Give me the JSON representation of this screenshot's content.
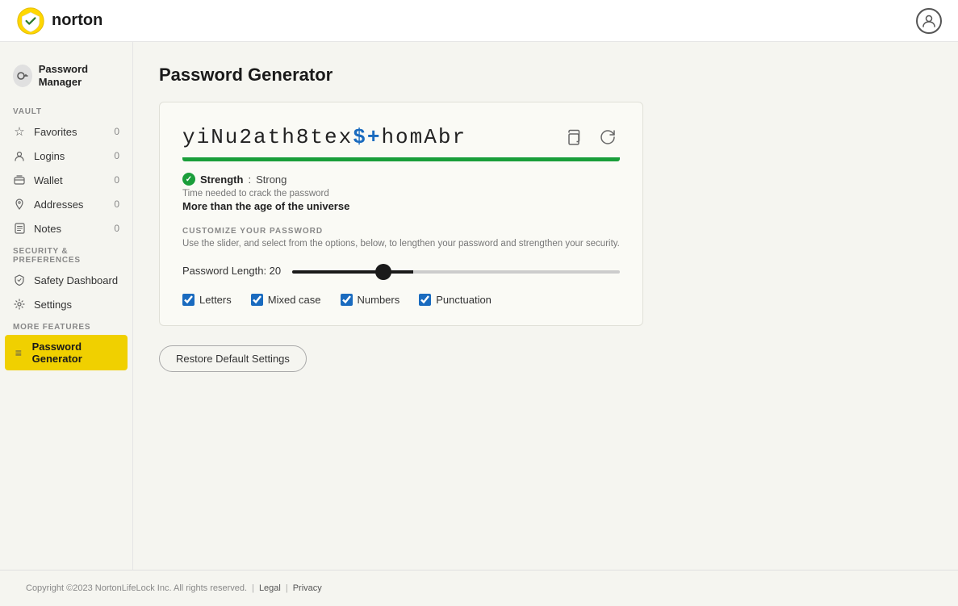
{
  "topNav": {
    "logoText": "norton",
    "userIconLabel": "User account"
  },
  "sidebar": {
    "passwordManagerTitle": "Password Manager",
    "sections": {
      "vault": {
        "label": "VAULT",
        "items": [
          {
            "id": "favorites",
            "label": "Favorites",
            "count": "0",
            "icon": "★"
          },
          {
            "id": "logins",
            "label": "Logins",
            "count": "0",
            "icon": "👤"
          },
          {
            "id": "wallet",
            "label": "Wallet",
            "count": "0",
            "icon": "📍"
          },
          {
            "id": "addresses",
            "label": "Addresses",
            "count": "0",
            "icon": "📍"
          },
          {
            "id": "notes",
            "label": "Notes",
            "count": "0",
            "icon": "📄"
          }
        ]
      },
      "security": {
        "label": "SECURITY & PREFERENCES",
        "items": [
          {
            "id": "safety-dashboard",
            "label": "Safety Dashboard",
            "icon": "🛡"
          },
          {
            "id": "settings",
            "label": "Settings",
            "icon": "⚙"
          }
        ]
      },
      "more": {
        "label": "MORE FEATURES",
        "items": [
          {
            "id": "password-generator",
            "label": "Password Generator",
            "icon": "≡",
            "active": true
          }
        ]
      }
    }
  },
  "main": {
    "pageTitle": "Password Generator",
    "password": {
      "text": "yiNu2ath8tex",
      "textHighlight": "$+",
      "textEnd": "homAbr",
      "copyIconLabel": "Copy to clipboard",
      "refreshIconLabel": "Regenerate password"
    },
    "strengthBar": {
      "color": "#1a9e3a",
      "widthPercent": 100
    },
    "strength": {
      "label": "Strength",
      "value": "Strong"
    },
    "crackTime": {
      "label": "Time needed to crack the password",
      "value": "More than the age of the universe"
    },
    "customize": {
      "sectionLabel": "CUSTOMIZE YOUR PASSWORD",
      "description": "Use the slider, and select from the options, below, to lengthen your password and strengthen your security."
    },
    "length": {
      "label": "Password Length: 20",
      "value": 20,
      "min": 4,
      "max": 64
    },
    "options": [
      {
        "id": "letters",
        "label": "Letters",
        "checked": true
      },
      {
        "id": "mixed-case",
        "label": "Mixed case",
        "checked": true
      },
      {
        "id": "numbers",
        "label": "Numbers",
        "checked": true
      },
      {
        "id": "punctuation",
        "label": "Punctuation",
        "checked": true
      }
    ],
    "restoreButton": "Restore Default Settings"
  },
  "footer": {
    "copyright": "Copyright ©2023 NortonLifeLock Inc. All rights reserved.",
    "legalLabel": "Legal",
    "privacyLabel": "Privacy"
  }
}
